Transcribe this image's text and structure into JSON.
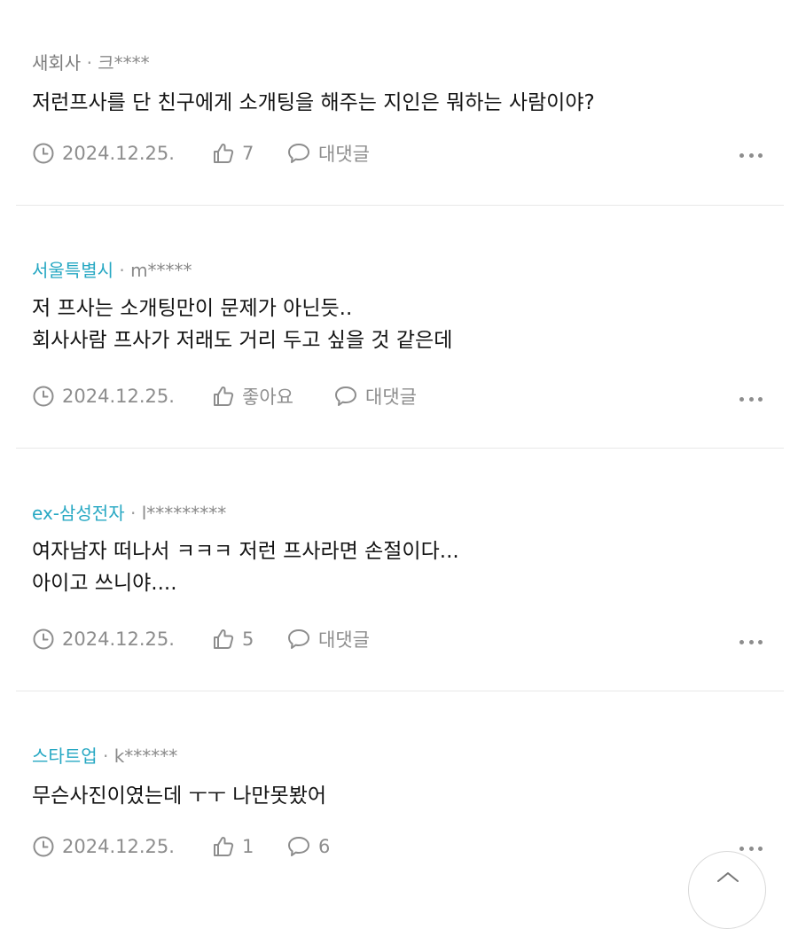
{
  "comments": [
    {
      "company": "새회사",
      "separator": "·",
      "nickname": "크****",
      "lines": [
        "저런프사를 단 친구에게 소개팅을 해주는 지인은 뭐하는 사람이야?"
      ],
      "date": "2024.12.25.",
      "likes": "7",
      "reply": "대댓글"
    },
    {
      "company": "서울특별시",
      "separator": "·",
      "nickname": "m*****",
      "lines": [
        "저 프사는 소개팅만이 문제가 아닌듯..",
        "회사사람 프사가 저래도 거리 두고 싶을 것 같은데"
      ],
      "date": "2024.12.25.",
      "likes": "좋아요",
      "reply": "대댓글"
    },
    {
      "company": "ex-삼성전자",
      "separator": "·",
      "nickname": "l*********",
      "lines": [
        "여자남자 떠나서 ㅋㅋㅋ 저런 프사라면 손절이다...",
        "아이고 쓰니야...."
      ],
      "date": "2024.12.25.",
      "likes": "5",
      "reply": "대댓글"
    },
    {
      "company": "스타트업",
      "separator": "·",
      "nickname": "k******",
      "lines": [
        "무슨사진이였는데 ㅜㅜ 나만못봤어"
      ],
      "date": "2024.12.25.",
      "likes": "1",
      "reply": "6"
    }
  ],
  "icons": {
    "clock": "clock-icon",
    "like": "thumbs-up-icon",
    "reply": "speech-bubble-icon",
    "more": "more-dots-icon",
    "scroll_top": "chevron-up-icon"
  },
  "colors": {
    "company_default": "#7c7c7c",
    "company_accent": "#27a8c3",
    "meta": "#8d8d8d",
    "text": "#141414",
    "divider": "#e8e8e8"
  }
}
